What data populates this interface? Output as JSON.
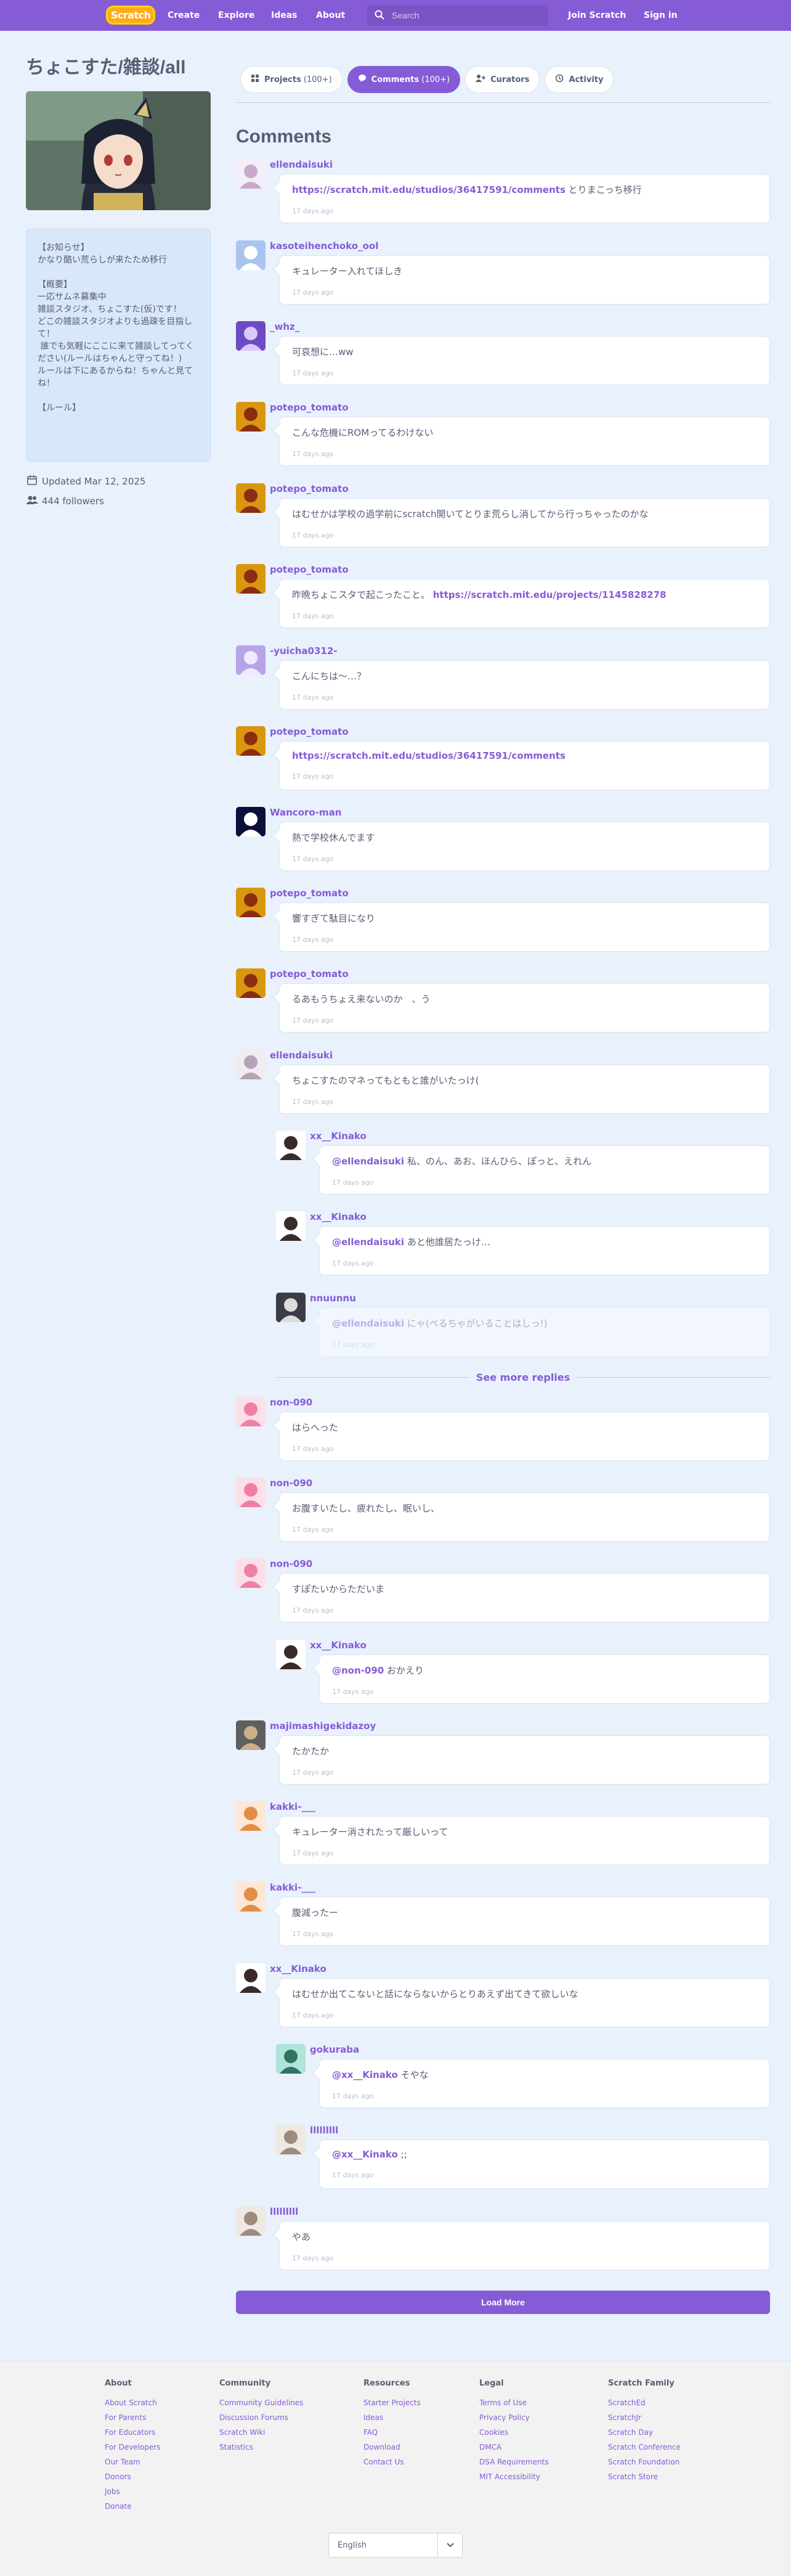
{
  "nav": {
    "logo_text": "Scratch",
    "links": [
      "Create",
      "Explore",
      "Ideas",
      "About"
    ],
    "search_placeholder": "Search",
    "join": "Join Scratch",
    "signin": "Sign in"
  },
  "studio": {
    "title": "ちょこすた/雑談/all",
    "description": "【お知らせ】\nかなり酷い荒らしが来たため移行\n\n【概要】\n一応サムネ募集中\n雑談スタジオ、ちょこすた(仮)です！\nどこの雑談スタジオよりも過疎を目指して！\n 誰でも気軽にここに来て雑談してってください(ルールはちゃんと守ってね！)\nルールは下にあるからね！ちゃんと見てね！\n\n【ルール】",
    "updated": "Updated Mar 12, 2025",
    "followers": "444 followers"
  },
  "tabs": [
    {
      "label": "Projects",
      "count": "(100+)",
      "icon": "projects-icon"
    },
    {
      "label": "Comments",
      "count": "(100+)",
      "icon": "comments-icon"
    },
    {
      "label": "Curators",
      "count": "",
      "icon": "curators-icon"
    },
    {
      "label": "Activity",
      "count": "",
      "icon": "activity-icon"
    }
  ],
  "comments_heading": "Comments",
  "comments": [
    {
      "user": "ellendaisuki",
      "link": "https://scratch.mit.edu/studios/36417591/comments",
      "text": " とりまこっち移行",
      "time": "17 days ago"
    },
    {
      "user": "kasoteihenchoko_ool",
      "link": "",
      "text": "キュレーター入れてほしき",
      "time": "17 days ago"
    },
    {
      "user": "_whz_",
      "link": "",
      "text": "可哀想に…ww",
      "time": "17 days ago"
    },
    {
      "user": "potepo_tomato",
      "link": "",
      "text": "こんな危機にROMってるわけない",
      "time": "17 days ago"
    },
    {
      "user": "potepo_tomato",
      "link": "",
      "text": "はむせかは学校の過学前にscratch開いてとりま荒らし消してから行っちゃったのかな",
      "time": "17 days ago"
    },
    {
      "user": "potepo_tomato",
      "link": "",
      "text": "昨晩ちょこスタで起こったこと。 ",
      "link2": "https://scratch.mit.edu/projects/1145828278",
      "time": "17 days ago"
    },
    {
      "user": "-yuicha0312-",
      "link": "",
      "text": "こんにちは〜…？",
      "time": "17 days ago"
    },
    {
      "user": "potepo_tomato",
      "link": "https://scratch.mit.edu/studios/36417591/comments",
      "text": "",
      "time": "17 days ago"
    },
    {
      "user": "Wancoro-man",
      "link": "",
      "text": "熱で学校休んでます",
      "time": "17 days ago"
    },
    {
      "user": "potepo_tomato",
      "link": "",
      "text": "響すぎて駄目になり",
      "time": "17 days ago"
    },
    {
      "user": "potepo_tomato",
      "link": "",
      "text": "るあもうちょえ来ないのか　、う",
      "time": "17 days ago"
    },
    {
      "user": "ellendaisuki",
      "link": "",
      "text": "ちょこすたのマネってもともと誰がいたっけ(",
      "time": "17 days ago"
    },
    {
      "user": "xx__Kinako",
      "link": "@ellendaisuki",
      "text": " 私、のん、あお、ほんひら、ぽっと、えれん",
      "time": "17 days ago",
      "reply": true
    },
    {
      "user": "xx__Kinako",
      "link": "@ellendaisuki",
      "text": " あと他誰居たっけ…",
      "time": "17 days ago",
      "reply": true
    },
    {
      "user": "nnuunnu",
      "link": "@ellendaisuki",
      "text": " にゃ(べるちゃがいることはしっ!)",
      "time": "17 days ago",
      "reply": true,
      "fade": true
    },
    {
      "user": "non-090",
      "link": "",
      "text": "はらへった",
      "time": "17 days ago"
    },
    {
      "user": "non-090",
      "link": "",
      "text": "お腹すいたし、疲れたし、眠いし、",
      "time": "17 days ago"
    },
    {
      "user": "non-090",
      "link": "",
      "text": "すぽたいからただいま",
      "time": "17 days ago"
    },
    {
      "user": "xx__Kinako",
      "link": "@non-090",
      "text": " おかえり",
      "time": "17 days ago",
      "reply": true
    },
    {
      "user": "majimashigekidazoy",
      "link": "",
      "text": "たかたか",
      "time": "17 days ago"
    },
    {
      "user": "kakki-___",
      "link": "",
      "text": "キュレーター消されたって厳しいって",
      "time": "17 days ago"
    },
    {
      "user": "kakki-___",
      "link": "",
      "text": "腹減ったー",
      "time": "17 days ago"
    },
    {
      "user": "xx__Kinako",
      "link": "",
      "text": "はむせか出てこないと話にならないからとりあえず出てきて欲しいな",
      "time": "17 days ago"
    },
    {
      "user": "gokuraba",
      "link": "@xx__Kinako",
      "text": " そやな",
      "time": "17 days ago",
      "reply": true
    },
    {
      "user": "lllllllll",
      "link": "@xx__Kinako",
      "text": " ;;",
      "time": "17 days ago",
      "reply": true
    },
    {
      "user": "lllllllll",
      "link": "",
      "text": "やあ",
      "time": "17 days ago"
    }
  ],
  "see_more_replies": "See more replies",
  "load_more": "Load More",
  "footer": {
    "columns": [
      {
        "title": "About",
        "links": [
          "About Scratch",
          "For Parents",
          "For Educators",
          "For Developers",
          "Our Team",
          "Donors",
          "Jobs",
          "Donate"
        ]
      },
      {
        "title": "Community",
        "links": [
          "Community Guidelines",
          "Discussion Forums",
          "Scratch Wiki",
          "Statistics"
        ]
      },
      {
        "title": "Resources",
        "links": [
          "Starter Projects",
          "Ideas",
          "FAQ",
          "Download",
          "Contact Us"
        ]
      },
      {
        "title": "Legal",
        "links": [
          "Terms of Use",
          "Privacy Policy",
          "Cookies",
          "DMCA",
          "DSA Requirements",
          "MIT Accessibility"
        ]
      },
      {
        "title": "Scratch Family",
        "links": [
          "ScratchEd",
          "ScratchJr",
          "Scratch Day",
          "Scratch Conference",
          "Scratch Foundation",
          "Scratch Store"
        ]
      }
    ],
    "language": "English"
  },
  "colors": {
    "brand": "#855cd6",
    "page_bg": "#e9f1fc",
    "text": "#575e75"
  }
}
